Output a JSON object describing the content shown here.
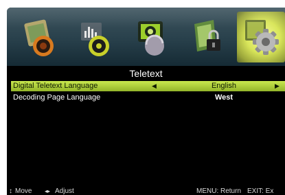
{
  "menu": {
    "tabs": [
      {
        "icon": "picture-icon",
        "active": false
      },
      {
        "icon": "sound-icon",
        "active": false
      },
      {
        "icon": "channel-icon",
        "active": false
      },
      {
        "icon": "lock-icon",
        "active": false
      },
      {
        "icon": "setup-gear-icon",
        "active": true
      }
    ],
    "title": "Teletext",
    "rows": [
      {
        "label": "Digital Teletext Language",
        "value": "English",
        "selected": true,
        "left_arrow": "◀",
        "right_arrow": "▶"
      },
      {
        "label": "Decoding Page Language",
        "value": "West",
        "selected": false
      }
    ]
  },
  "footer": {
    "move_icon": "↕",
    "move": "Move",
    "adjust_icon": "◂▸",
    "adjust": "Adjust",
    "return": "MENU: Return",
    "exit": "EXIT: Ex"
  },
  "colors": {
    "highlight": "#b5d83c",
    "background": "#000000",
    "iconbar": "#2f4651",
    "active_tab": "#e4ee6c"
  }
}
